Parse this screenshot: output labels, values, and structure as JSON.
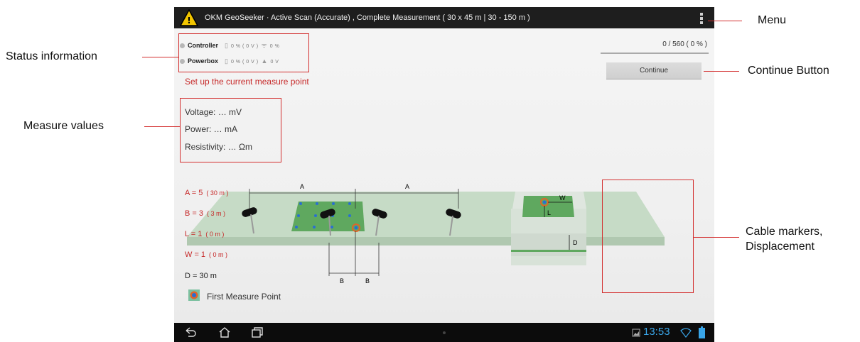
{
  "app": {
    "title": "OKM GeoSeeker · Active Scan (Accurate) , Complete Measurement ( 30 x 45 m | 30 - 150 m )",
    "logo_icon": "warning-triangle-icon",
    "menu_icon": "overflow-menu-icon"
  },
  "status": {
    "controller": {
      "label": "Controller",
      "battery": "0 % ( 0 V )",
      "signal": "0 %"
    },
    "powerbox": {
      "label": "Powerbox",
      "battery": "0 % ( 0 V )",
      "voltage": "0 V"
    }
  },
  "setup_message": "Set up the current measure point",
  "measure": {
    "voltage": "Voltage: … mV",
    "power": "Power: … mA",
    "resistivity": "Resistivity: … Ωm"
  },
  "progress": {
    "text": "0 / 560 ( 0 % )",
    "fraction": 0
  },
  "continue_label": "Continue",
  "scene": {
    "a_label": "A",
    "b_label": "B",
    "w_label": "W",
    "l_label": "L",
    "d_label": "D"
  },
  "cables": {
    "a": {
      "main": "A = 5",
      "paren": "( 30 m )"
    },
    "b": {
      "main": "B = 3",
      "paren": "( 3 m )"
    },
    "l": {
      "main": "L = 1",
      "paren": "( 0 m )"
    },
    "w": {
      "main": "W = 1",
      "paren": "( 0 m )"
    },
    "d": {
      "main": "D = 30 m"
    }
  },
  "legend_label": "First Measure Point",
  "clock": "13:53",
  "colors": {
    "accent_red": "#d32f2f",
    "titlebar": "#1e1e1e",
    "clock": "#39a5e8",
    "plate": "#c8dcc8"
  },
  "annotations": {
    "menu": "Menu",
    "status_information": "Status information",
    "continue_button": "Continue Button",
    "measure_values": "Measure values",
    "cable_markers_line1": "Cable markers,",
    "cable_markers_line2": "Displacement"
  }
}
